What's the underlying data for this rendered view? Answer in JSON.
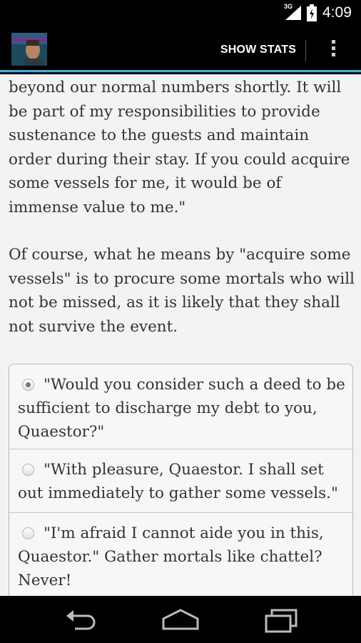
{
  "status_bar": {
    "network": "3G",
    "time": "4:09"
  },
  "action_bar": {
    "show_stats_label": "SHOW STATS"
  },
  "content": {
    "paragraph_1": "beyond our normal numbers shortly. It will be part of my responsibilities to provide sustenance to the guests and maintain order during their stay. If you could acquire some vessels for me, it would be of immense value to me.\"",
    "paragraph_2": "Of course, what he means by \"acquire some vessels\" is to procure some mortals who will not be missed, as it is likely that they shall not survive the event."
  },
  "choices": [
    {
      "label": "\"Would you consider such a deed to be sufficient to discharge my debt to you, Quaestor?\"",
      "selected": true
    },
    {
      "label": "\"With pleasure, Quaestor. I shall set out immediately to gather some vessels.\"",
      "selected": false
    },
    {
      "label": "\"I'm afraid I cannot aide you in this, Quaestor.\" Gather mortals like chattel? Never!",
      "selected": false
    }
  ],
  "icons": {
    "signal": "signal-icon",
    "battery": "battery-icon",
    "app": "app-icon",
    "overflow": "overflow-menu-icon",
    "back": "back-icon",
    "home": "home-icon",
    "recent": "recent-apps-icon"
  },
  "colors": {
    "accent": "#33b5e5",
    "background": "#f3f3f3",
    "text": "#333333"
  }
}
